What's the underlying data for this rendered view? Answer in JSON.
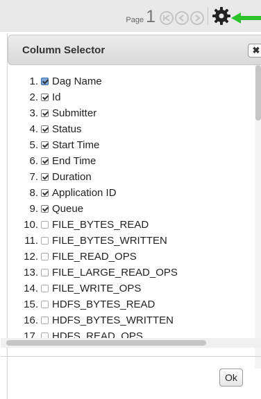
{
  "pager": {
    "label": "Page",
    "current": "1"
  },
  "colors": {
    "arrow": "#2cc22c",
    "gear": "#222222"
  },
  "dialog": {
    "title": "Column Selector",
    "close_label": "✖",
    "ok_label": "Ok",
    "columns": [
      {
        "num": "1.",
        "label": "Dag Name",
        "checked": true,
        "focused": true
      },
      {
        "num": "2.",
        "label": "Id",
        "checked": true
      },
      {
        "num": "3.",
        "label": "Submitter",
        "checked": true
      },
      {
        "num": "4.",
        "label": "Status",
        "checked": true
      },
      {
        "num": "5.",
        "label": "Start Time",
        "checked": true
      },
      {
        "num": "6.",
        "label": "End Time",
        "checked": true
      },
      {
        "num": "7.",
        "label": "Duration",
        "checked": true
      },
      {
        "num": "8.",
        "label": "Application ID",
        "checked": true
      },
      {
        "num": "9.",
        "label": "Queue",
        "checked": true
      },
      {
        "num": "10.",
        "label": "FILE_BYTES_READ",
        "checked": false
      },
      {
        "num": "11.",
        "label": "FILE_BYTES_WRITTEN",
        "checked": false
      },
      {
        "num": "12.",
        "label": "FILE_READ_OPS",
        "checked": false
      },
      {
        "num": "13.",
        "label": "FILE_LARGE_READ_OPS",
        "checked": false
      },
      {
        "num": "14.",
        "label": "FILE_WRITE_OPS",
        "checked": false
      },
      {
        "num": "15.",
        "label": "HDFS_BYTES_READ",
        "checked": false
      },
      {
        "num": "16.",
        "label": "HDFS_BYTES_WRITTEN",
        "checked": false
      },
      {
        "num": "17.",
        "label": "HDFS_READ_OPS",
        "checked": false
      }
    ]
  },
  "icons": {
    "first": "first-page-icon",
    "prev": "prev-page-icon",
    "next": "next-page-icon",
    "settings": "gear-icon",
    "pointer": "arrow-icon"
  }
}
